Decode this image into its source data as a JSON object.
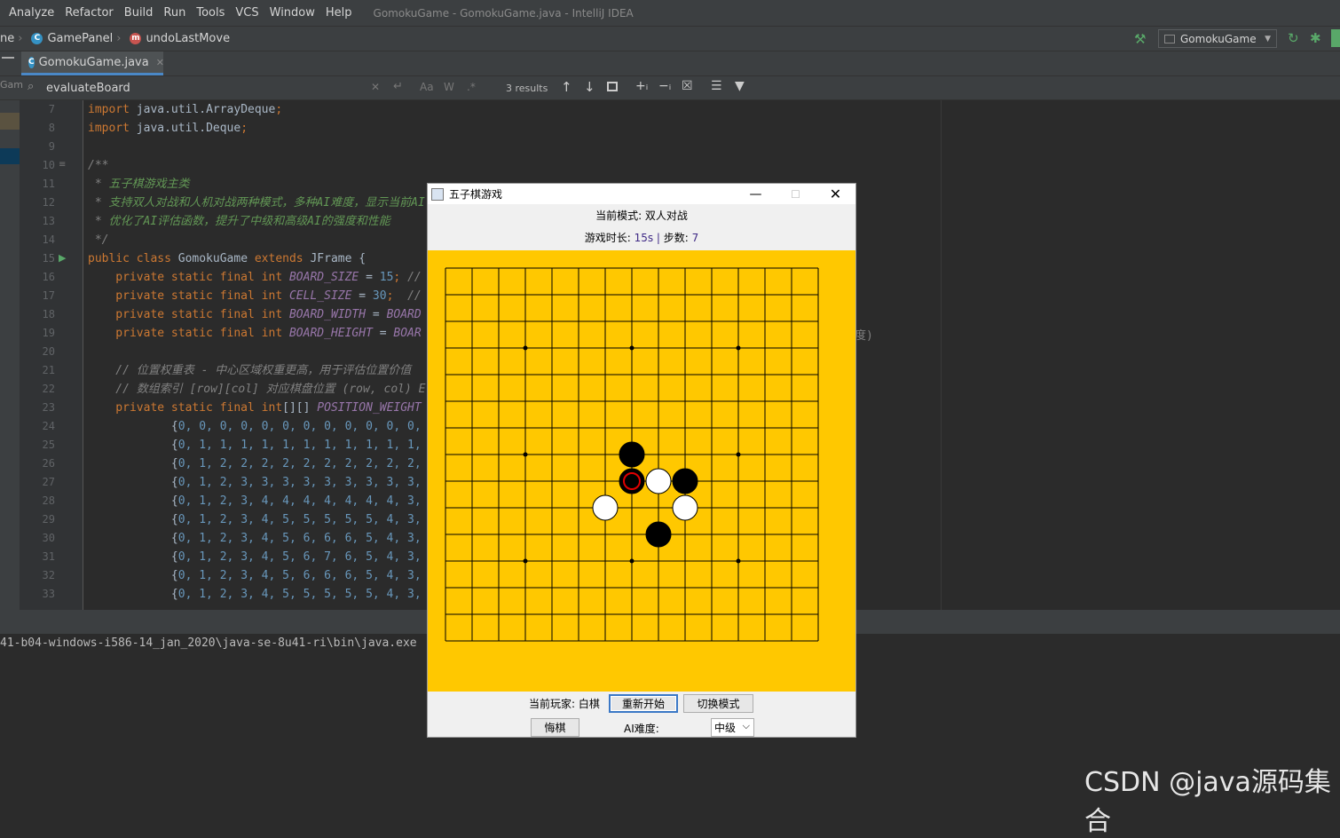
{
  "ide": {
    "menu": [
      "Analyze",
      "Refactor",
      "Build",
      "Run",
      "Tools",
      "VCS",
      "Window",
      "Help"
    ],
    "window_title": "GomokuGame - GomokuGame.java - IntelliJ IDEA",
    "breadcrumb": {
      "prefix": "ne",
      "class": "GamePanel",
      "method": "undoLastMove"
    },
    "run_config": "GomokuGame",
    "tab": "GomokuGame.java",
    "left_stub": "Gam",
    "search": {
      "value": "evaluateBoard",
      "results": "3 results"
    },
    "console_line": "41-b04-windows-i586-14_jan_2020\\java-se-8u41-ri\\bin\\java.exe",
    "hidden_text_fragment": "度)",
    "watermark": "CSDN @java源码集合"
  },
  "code": {
    "line_numbers": [
      "7",
      "8",
      "9",
      "10",
      "11",
      "12",
      "13",
      "14",
      "15",
      "16",
      "17",
      "18",
      "19",
      "20",
      "21",
      "22",
      "23",
      "24",
      "25",
      "26",
      "27",
      "28",
      "29",
      "30",
      "31",
      "32",
      "33"
    ],
    "lines": [
      [
        [
          "kw",
          "import "
        ],
        [
          "id",
          "java.util.ArrayDeque"
        ],
        [
          "kw",
          ";"
        ]
      ],
      [
        [
          "kw",
          "import "
        ],
        [
          "id",
          "java.util.Deque"
        ],
        [
          "kw",
          ";"
        ]
      ],
      [],
      [
        [
          "cmt",
          "/**"
        ]
      ],
      [
        [
          "cmt",
          " * "
        ],
        [
          "doc",
          "五子棋游戏主类"
        ]
      ],
      [
        [
          "cmt",
          " * "
        ],
        [
          "doc",
          "支持双人对战和人机对战两种模式，多种AI难度，显示当前AI"
        ]
      ],
      [
        [
          "cmt",
          " * "
        ],
        [
          "doc",
          "优化了AI评估函数，提升了中级和高级AI的强度和性能"
        ]
      ],
      [
        [
          "cmt",
          " */"
        ]
      ],
      [
        [
          "kw",
          "public class "
        ],
        [
          "id",
          "GomokuGame "
        ],
        [
          "kw",
          "extends "
        ],
        [
          "id",
          "JFrame {"
        ]
      ],
      [
        [
          "kw",
          "    private static final int "
        ],
        [
          "cn",
          "BOARD_SIZE"
        ],
        [
          "id",
          " = "
        ],
        [
          "num",
          "15"
        ],
        [
          "kw",
          "; "
        ],
        [
          "cmt",
          "//"
        ]
      ],
      [
        [
          "kw",
          "    private static final int "
        ],
        [
          "cn",
          "CELL_SIZE"
        ],
        [
          "id",
          " = "
        ],
        [
          "num",
          "30"
        ],
        [
          "kw",
          ";  "
        ],
        [
          "cmt",
          "//"
        ]
      ],
      [
        [
          "kw",
          "    private static final int "
        ],
        [
          "cn",
          "BOARD_WIDTH"
        ],
        [
          "id",
          " = "
        ],
        [
          "cn",
          "BOARD"
        ]
      ],
      [
        [
          "kw",
          "    private static final int "
        ],
        [
          "cn",
          "BOARD_HEIGHT"
        ],
        [
          "id",
          " = "
        ],
        [
          "cn",
          "BOAR"
        ]
      ],
      [],
      [
        [
          "cmt",
          "    // 位置权重表 - 中心区域权重更高，用于评估位置价值"
        ]
      ],
      [
        [
          "cmt",
          "    // 数组索引 [row][col] 对应棋盘位置 (row, col) E"
        ]
      ],
      [
        [
          "kw",
          "    private static final "
        ],
        [
          "kw",
          "int"
        ],
        [
          "id",
          "[][] "
        ],
        [
          "cn",
          "POSITION_WEIGHT"
        ]
      ],
      [
        [
          "id",
          "            {"
        ],
        [
          "num",
          "0, 0, 0, 0, 0, 0, 0, 0, 0, 0, 0, 0,"
        ]
      ],
      [
        [
          "id",
          "            {"
        ],
        [
          "num",
          "0, 1, 1, 1, 1, 1, 1, 1, 1, 1, 1, 1,"
        ]
      ],
      [
        [
          "id",
          "            {"
        ],
        [
          "num",
          "0, 1, 2, 2, 2, 2, 2, 2, 2, 2, 2, 2,"
        ]
      ],
      [
        [
          "id",
          "            {"
        ],
        [
          "num",
          "0, 1, 2, 3, 3, 3, 3, 3, 3, 3, 3, 3,"
        ]
      ],
      [
        [
          "id",
          "            {"
        ],
        [
          "num",
          "0, 1, 2, 3, 4, 4, 4, 4, 4, 4, 4, 3,"
        ]
      ],
      [
        [
          "id",
          "            {"
        ],
        [
          "num",
          "0, 1, 2, 3, 4, 5, 5, 5, 5, 5, 4, 3,"
        ]
      ],
      [
        [
          "id",
          "            {"
        ],
        [
          "num",
          "0, 1, 2, 3, 4, 5, 6, 6, 6, 5, 4, 3,"
        ]
      ],
      [
        [
          "id",
          "            {"
        ],
        [
          "num",
          "0, 1, 2, 3, 4, 5, 6, 7, 6, 5, 4, 3,"
        ]
      ],
      [
        [
          "id",
          "            {"
        ],
        [
          "num",
          "0, 1, 2, 3, 4, 5, 6, 6, 6, 5, 4, 3,"
        ]
      ],
      [
        [
          "id",
          "            {"
        ],
        [
          "num",
          "0, 1, 2, 3, 4, 5, 5, 5, 5, 5, 4, 3,"
        ]
      ]
    ]
  },
  "game": {
    "title": "五子棋游戏",
    "mode_text": "当前模式: 双人对战",
    "time_label": "游戏时长: ",
    "time_value": "15s",
    "time_sep": " | ",
    "steps_label": "步数: ",
    "steps_value": "7",
    "current_player": "当前玩家: 白棋",
    "restart_button": "重新开始",
    "switch_mode_button": "切换模式",
    "undo_button": "悔棋",
    "ai_label": "AI难度:",
    "difficulty": "中级",
    "board_size": 15,
    "colors": {
      "board": "#ffc800",
      "last_move_ring": "#e00000"
    },
    "stars": [
      [
        3,
        3
      ],
      [
        3,
        7
      ],
      [
        3,
        11
      ],
      [
        7,
        3
      ],
      [
        7,
        11
      ],
      [
        11,
        3
      ],
      [
        11,
        7
      ],
      [
        11,
        11
      ]
    ],
    "stones": [
      {
        "row": 7,
        "col": 7,
        "color": "black",
        "last": false
      },
      {
        "row": 8,
        "col": 7,
        "color": "black",
        "last": true
      },
      {
        "row": 8,
        "col": 8,
        "color": "white",
        "last": false
      },
      {
        "row": 8,
        "col": 9,
        "color": "black",
        "last": false
      },
      {
        "row": 9,
        "col": 6,
        "color": "white",
        "last": false
      },
      {
        "row": 9,
        "col": 9,
        "color": "white",
        "last": false
      },
      {
        "row": 10,
        "col": 8,
        "color": "black",
        "last": false
      }
    ]
  }
}
